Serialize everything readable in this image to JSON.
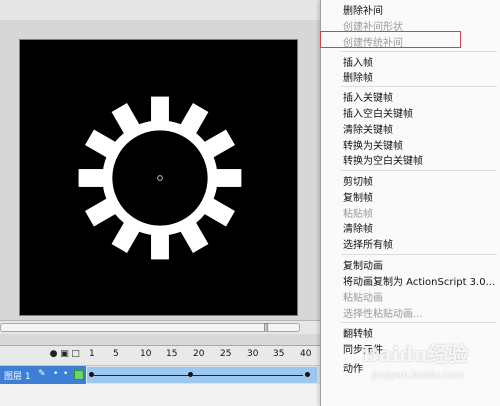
{
  "menu": {
    "items": [
      {
        "label": "删除补间",
        "enabled": true
      },
      {
        "label": "创建补间形状",
        "enabled": false
      },
      {
        "label": "创建传统补间",
        "enabled": false,
        "highlighted": true
      },
      {
        "label": "插入帧",
        "enabled": true
      },
      {
        "label": "删除帧",
        "enabled": true
      },
      {
        "label": "插入关键帧",
        "enabled": true
      },
      {
        "label": "插入空白关键帧",
        "enabled": true
      },
      {
        "label": "清除关键帧",
        "enabled": true
      },
      {
        "label": "转换为关键帧",
        "enabled": true
      },
      {
        "label": "转换为空白关键帧",
        "enabled": true
      },
      {
        "label": "剪切帧",
        "enabled": true
      },
      {
        "label": "复制帧",
        "enabled": true
      },
      {
        "label": "粘贴帧",
        "enabled": false
      },
      {
        "label": "清除帧",
        "enabled": true
      },
      {
        "label": "选择所有帧",
        "enabled": true
      },
      {
        "label": "复制动画",
        "enabled": true
      },
      {
        "label": "将动画复制为 ActionScript 3.0...",
        "enabled": true
      },
      {
        "label": "粘贴动画",
        "enabled": false
      },
      {
        "label": "选择性粘贴动画...",
        "enabled": false
      },
      {
        "label": "翻转帧",
        "enabled": true
      },
      {
        "label": "同步元件",
        "enabled": true
      },
      {
        "label": "动作",
        "enabled": true
      }
    ]
  },
  "timeline": {
    "frame_numbers": [
      "1",
      "5",
      "10",
      "15",
      "20",
      "25",
      "30",
      "35",
      "40"
    ],
    "layer_name": "图层 1",
    "header_icons": [
      "eye-icon",
      "lock-icon",
      "outline-icon"
    ]
  },
  "scrollbar": {
    "grip": "|||"
  },
  "watermark": {
    "main": "Baidu经验",
    "sub": "jingyan.baidu.com"
  },
  "colors": {
    "canvas": "#000000",
    "gear": "#ffffff",
    "frame_selection": "#9cc7f1",
    "highlight": "#c8474a",
    "layer": "#3d7ed6",
    "playhead": "#e23a3a"
  }
}
